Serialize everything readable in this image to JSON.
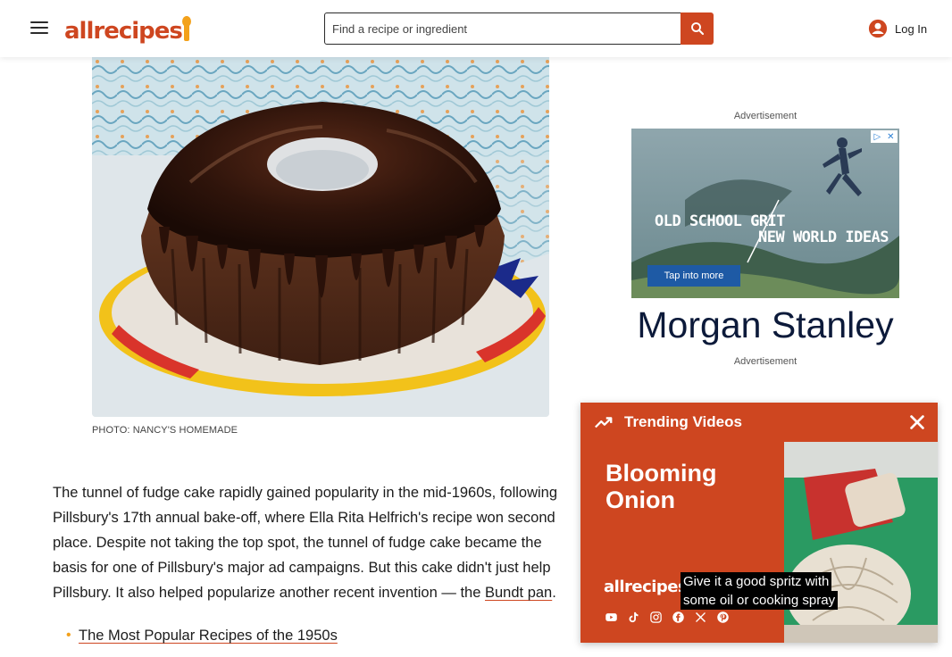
{
  "header": {
    "logo_text": "allrecipes",
    "search_placeholder": "Find a recipe or ingredient",
    "login_label": "Log In",
    "icons": {
      "menu": "hamburger-menu-icon",
      "search": "search-icon",
      "account": "account-circle-icon"
    }
  },
  "article": {
    "photo_caption": "PHOTO: NANCY'S HOMEMADE",
    "paragraph_before_link": "The tunnel of fudge cake rapidly gained popularity in the mid-1960s, following Pillsbury's 17th annual bake-off, where Ella Rita Helfrich's recipe won second place. Despite not taking the top spot, the tunnel of fudge cake became the basis for one of Pillsbury's major ad campaigns. But this cake didn't just help Pillsbury. It also helped popularize another recent invention — the ",
    "paragraph_link": "Bundt pan",
    "paragraph_after_link": ".",
    "related_links": [
      "The Most Popular Recipes of the 1950s"
    ]
  },
  "ad": {
    "label_top": "Advertisement",
    "label_bottom": "Advertisement",
    "headline_1": "OLD SCHOOL GRIT",
    "headline_2": "NEW WORLD IDEAS",
    "cta": "Tap into more",
    "brand": "Morgan Stanley"
  },
  "trending": {
    "title": "Trending Videos",
    "video_headline": "Blooming\nOnion",
    "video_logo": "allrecipes",
    "video_caption_1": "Give it a good spritz with",
    "video_caption_2": "some oil or cooking spray",
    "social_icons": [
      "youtube-icon",
      "tiktok-icon",
      "instagram-icon",
      "facebook-icon",
      "x-icon",
      "pinterest-icon"
    ]
  },
  "colors": {
    "brand": "#ce4620",
    "accent": "#f3a11b",
    "ad_navy": "#0c1a3a"
  }
}
